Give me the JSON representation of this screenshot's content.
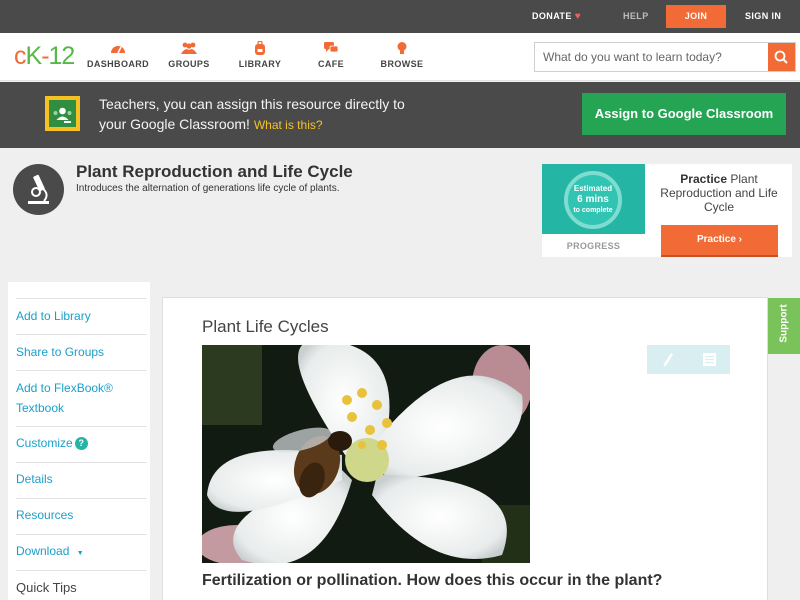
{
  "topbar": {
    "donate": "DONATE",
    "help": "HELP",
    "join": "JOIN",
    "signin": "SIGN IN"
  },
  "header": {
    "logo": {
      "c": "c",
      "k": "K",
      "dash": "-",
      "num": "12"
    },
    "nav": [
      {
        "label": "DASHBOARD",
        "icon": "gauge-icon"
      },
      {
        "label": "GROUPS",
        "icon": "people-icon"
      },
      {
        "label": "LIBRARY",
        "icon": "backpack-icon"
      },
      {
        "label": "CAFE",
        "icon": "chat-icon"
      },
      {
        "label": "BROWSE",
        "icon": "bulb-icon"
      }
    ],
    "search_placeholder": "What do you want to learn today?"
  },
  "classroom": {
    "line1": "Teachers, you can assign this resource directly to",
    "line2": "your Google Classroom!",
    "what": "What is this?",
    "button": "Assign to Google Classroom"
  },
  "page": {
    "title": "Plant Reproduction and Life Cycle",
    "subtitle": "Introduces the alternation of generations life cycle of plants."
  },
  "practice": {
    "estimated": "Estimated",
    "mins": "6 mins",
    "complete": "to complete",
    "progress": "PROGRESS",
    "bold": "Practice",
    "text": "Plant Reproduction and Life Cycle",
    "button": "Practice"
  },
  "sidebar": {
    "items": [
      {
        "label": "Add to Library"
      },
      {
        "label": "Share to Groups"
      },
      {
        "label": "Add to FlexBook®",
        "label2": "Textbook"
      },
      {
        "label": "Customize"
      },
      {
        "label": "Details"
      },
      {
        "label": "Resources"
      },
      {
        "label": "Download"
      }
    ],
    "help_glyph": "?",
    "dropdown_glyph": "▼",
    "quick_tips": "Quick Tips"
  },
  "content": {
    "heading": "Plant Life Cycles",
    "question": "Fertilization or pollination. How does this occur in the plant?"
  },
  "support": "Support",
  "colors": {
    "accent": "#f26a35",
    "green_button": "#25a454",
    "link": "#1a9fcb",
    "teal": "#25b5a5",
    "dark_band": "#4a4a4a"
  }
}
